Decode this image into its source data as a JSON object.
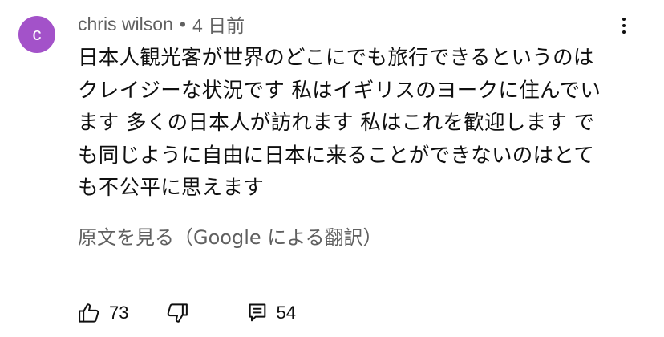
{
  "comment": {
    "avatar_letter": "c",
    "avatar_color": "#a352c9",
    "author": "chris wilson",
    "separator": "•",
    "timestamp": "4 日前",
    "lines": [
      "日本人観光客が世界のどこにでも旅行できるというのは",
      "クレイジーな状況です 私はイギリスのヨークに住んでい",
      "ます 多くの日本人が訪れます 私はこれを歓迎します で",
      "も同じように自由に日本に来ることができないのはとて",
      "も不公平に思えます"
    ],
    "translate_label": "原文を見る（Google による翻訳）",
    "like_count": "73",
    "reply_count": "54",
    "icons": {
      "menu": "more-vertical-icon",
      "like": "thumbs-up-icon",
      "dislike": "thumbs-down-icon",
      "reply": "reply-icon"
    }
  }
}
